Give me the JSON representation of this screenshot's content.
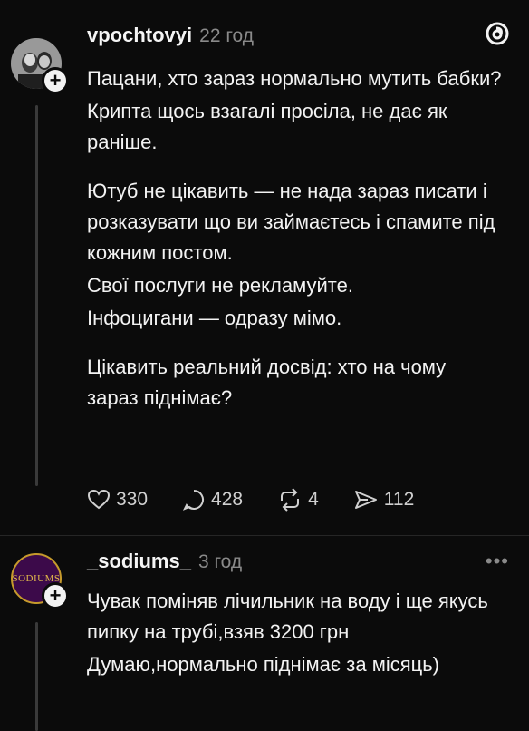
{
  "post1": {
    "username": "vpochtovyi",
    "time": "22 год",
    "paragraphs": [
      "Пацани, хто зараз нормально мутить бабки?",
      "Крипта щось взагалі просіла, не дає як раніше.",
      "Ютуб не цікавить — не нада зараз писати і розказувати що ви займаєтесь і спамите під кожним постом.",
      "Свої послуги не рекламуйте.",
      "Інфоцигани — одразу мімо.",
      "Цікавить реальний досвід: хто на чому зараз піднімає?"
    ],
    "likes": "330",
    "comments": "428",
    "reposts": "4",
    "shares": "112"
  },
  "post2": {
    "username": "_sodiums_",
    "time": "3 год",
    "avatar_text": "SODIUMS",
    "paragraphs": [
      "Чувак поміняв лічильник на воду і ще якусь пипку на трубі,взяв 3200 грн",
      "Думаю,нормально піднімає за місяць)"
    ]
  },
  "colors": {
    "background": "#0b0b0b",
    "text": "#f3f3f3",
    "muted": "#8a8a8a"
  }
}
